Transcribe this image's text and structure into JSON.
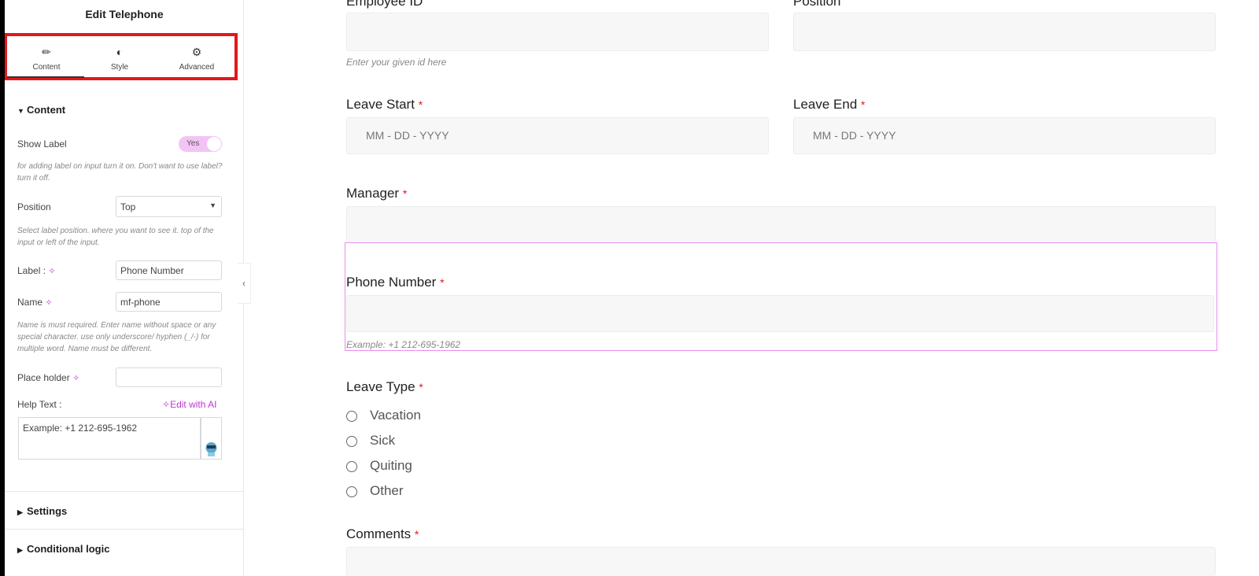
{
  "panel": {
    "title": "Edit Telephone",
    "tabs": [
      {
        "label": "Content",
        "icon": "pencil-icon"
      },
      {
        "label": "Style",
        "icon": "contrast-icon"
      },
      {
        "label": "Advanced",
        "icon": "gear-icon"
      }
    ],
    "content_section": "Content",
    "show_label": {
      "label": "Show Label",
      "toggle": "Yes",
      "help": "for adding label on input turn it on. Don't want to use label? turn it off."
    },
    "position": {
      "label": "Position",
      "value": "Top",
      "help": "Select label position. where you want to see it. top of the input or left of the input."
    },
    "label_field": {
      "label": "Label :",
      "value": "Phone Number"
    },
    "name_field": {
      "label": "Name",
      "value": "mf-phone",
      "help": "Name is must required. Enter name without space or any special character. use only underscore/ hyphen (_/-) for multiple word. Name must be different."
    },
    "placeholder_field": {
      "label": "Place holder",
      "value": ""
    },
    "help_text": {
      "label": "Help Text :",
      "ai_link": "Edit with AI",
      "value": "Example: +1 212-695-1962"
    },
    "settings_section": "Settings",
    "conditional_section": "Conditional logic"
  },
  "form": {
    "employee_id": {
      "label": "Employee ID",
      "help": "Enter your given id here"
    },
    "position": {
      "label": "Position"
    },
    "leave_start": {
      "label": "Leave Start",
      "placeholder": "MM - DD - YYYY"
    },
    "leave_end": {
      "label": "Leave End",
      "placeholder": "MM - DD - YYYY"
    },
    "manager": {
      "label": "Manager"
    },
    "phone": {
      "label": "Phone Number",
      "help": "Example: +1 212-695-1962"
    },
    "leave_type": {
      "label": "Leave Type",
      "options": [
        "Vacation",
        "Sick",
        "Quiting",
        "Other"
      ]
    },
    "comments": {
      "label": "Comments"
    },
    "required_mark": "*"
  },
  "colors": {
    "accent": "#c036d6",
    "highlight": "#e3171b",
    "toggle_bg": "#f2c4f5"
  }
}
